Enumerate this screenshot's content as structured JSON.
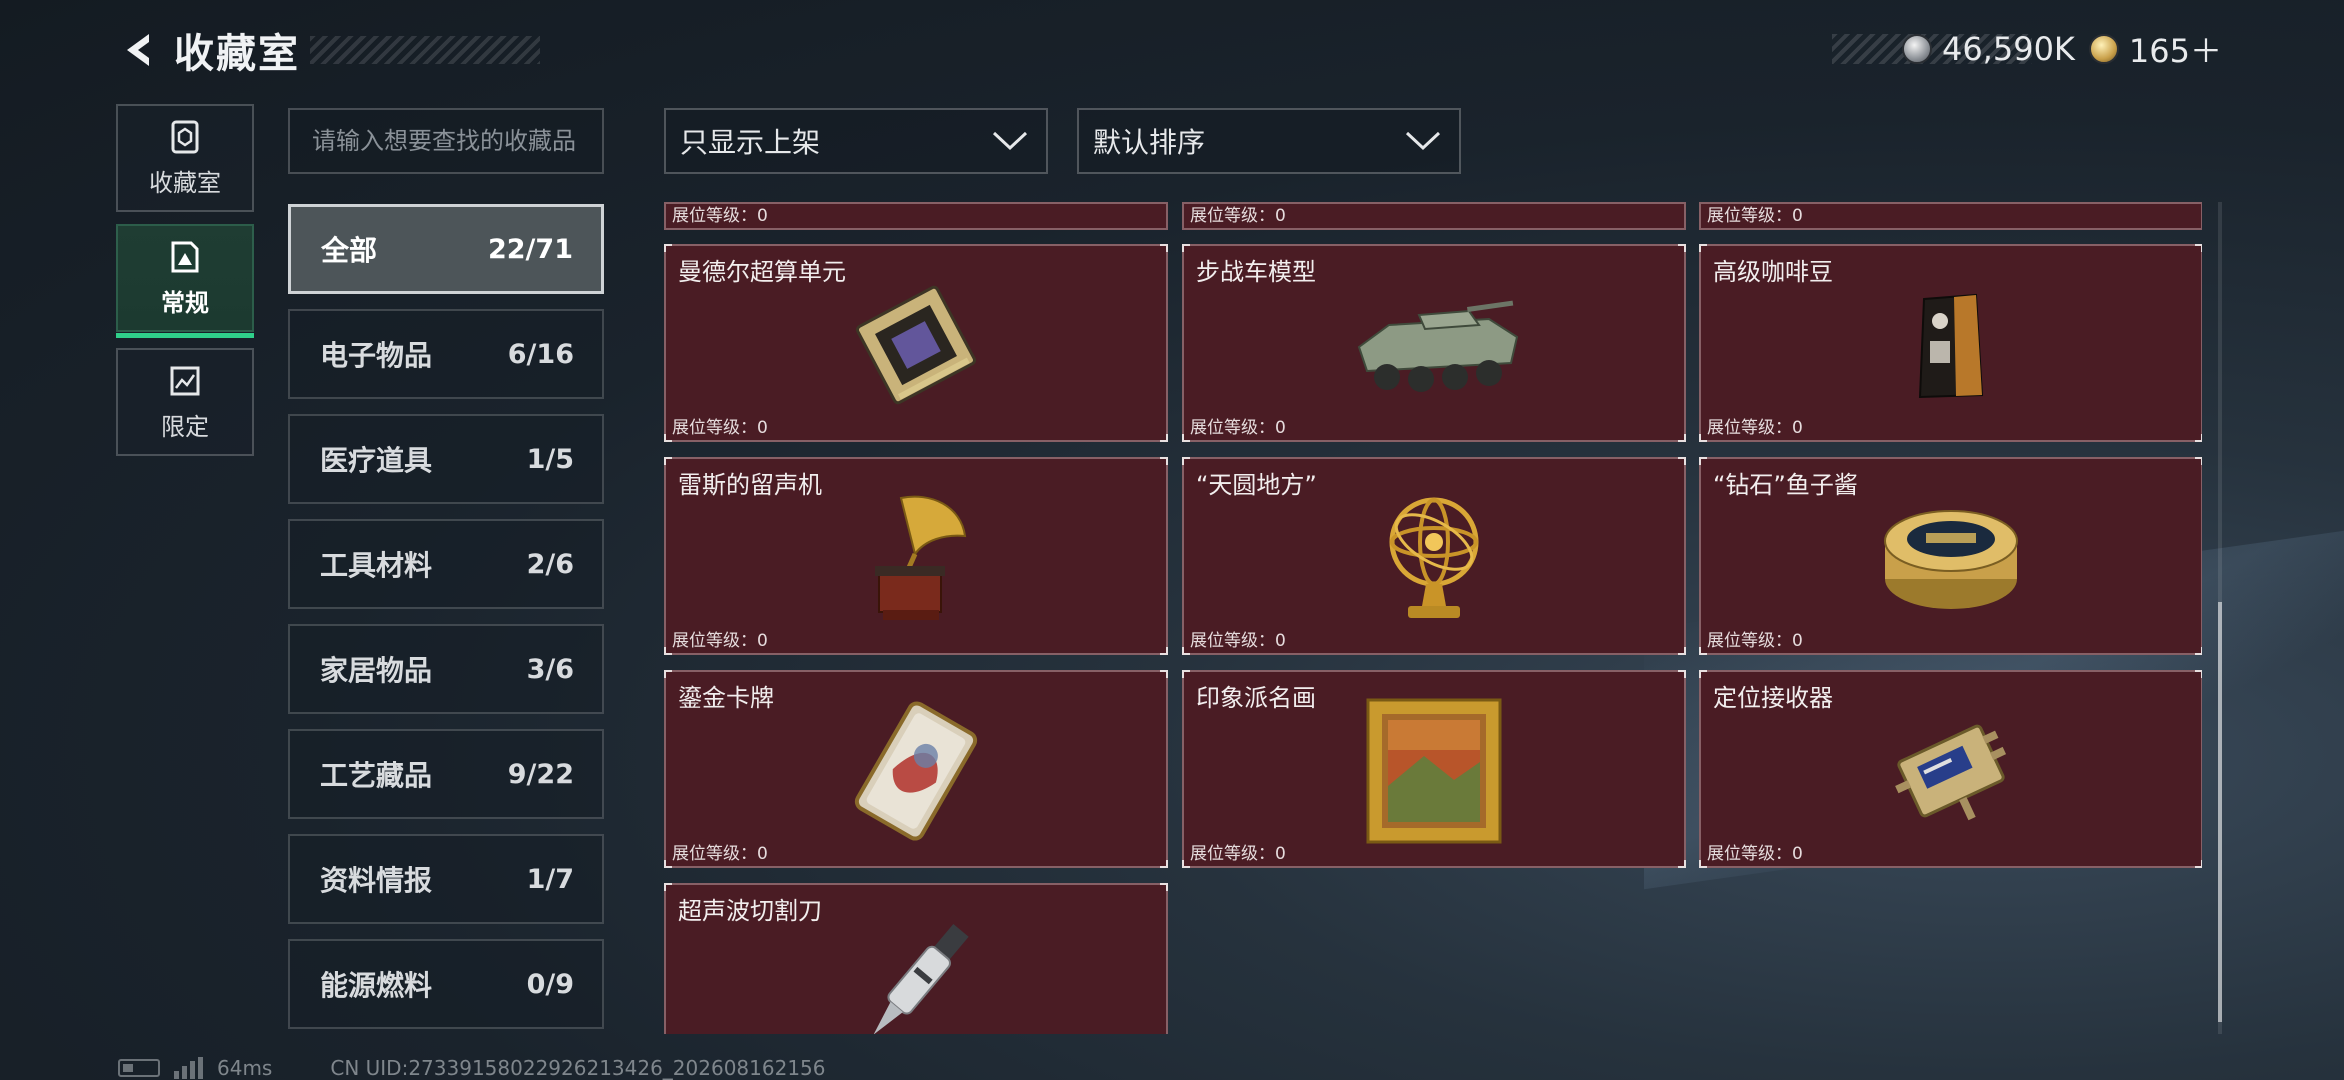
{
  "header": {
    "title": "收藏室"
  },
  "currency": {
    "silver": "46,590K",
    "gold": "165＋"
  },
  "side_tabs": [
    {
      "label": "收藏室",
      "icon": "collection-room-icon"
    },
    {
      "label": "常规",
      "icon": "regular-icon"
    },
    {
      "label": "限定",
      "icon": "limited-icon"
    }
  ],
  "search": {
    "placeholder": "请输入想要查找的收藏品",
    "value": ""
  },
  "filters": {
    "display": "只显示上架",
    "sort": "默认排序"
  },
  "categories": [
    {
      "name": "全部",
      "count": "22/71"
    },
    {
      "name": "电子物品",
      "count": "6/16"
    },
    {
      "name": "医疗道具",
      "count": "1/5"
    },
    {
      "name": "工具材料",
      "count": "2/6"
    },
    {
      "name": "家居物品",
      "count": "3/6"
    },
    {
      "name": "工艺藏品",
      "count": "9/22"
    },
    {
      "name": "资料情报",
      "count": "1/7"
    },
    {
      "name": "能源燃料",
      "count": "0/9"
    }
  ],
  "level_label": "展位等级：0",
  "items": [
    {
      "name": "曼德尔超算单元",
      "icon": "cpu-unit-icon"
    },
    {
      "name": "步战车模型",
      "icon": "ifv-model-icon"
    },
    {
      "name": "高级咖啡豆",
      "icon": "coffee-bag-icon"
    },
    {
      "name": "雷斯的留声机",
      "icon": "gramophone-icon"
    },
    {
      "name": "“天圆地方”",
      "icon": "armillary-sphere-icon"
    },
    {
      "name": "“钻石”鱼子酱",
      "icon": "caviar-tin-icon"
    },
    {
      "name": "鎏金卡牌",
      "icon": "gilded-card-icon"
    },
    {
      "name": "印象派名画",
      "icon": "framed-painting-icon"
    },
    {
      "name": "定位接收器",
      "icon": "gps-receiver-icon"
    },
    {
      "name": "超声波切割刀",
      "icon": "ultrasonic-knife-icon"
    }
  ],
  "footer": {
    "ping": "64ms",
    "uid": "CN UID:27339158022926213426_202608162156"
  }
}
